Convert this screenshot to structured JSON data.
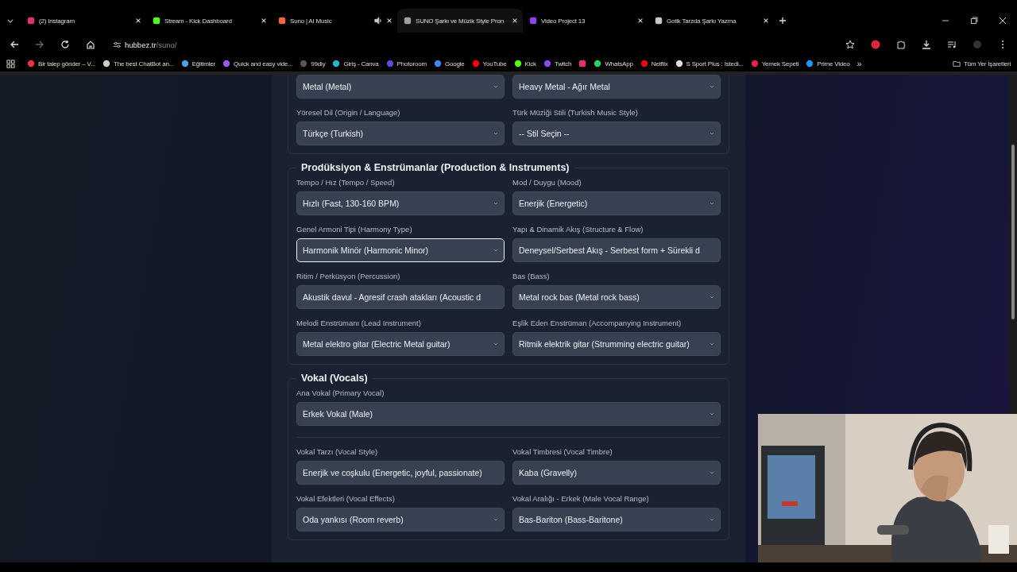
{
  "tabs": [
    {
      "title": "(2) Instagram",
      "selected": false,
      "audio": false
    },
    {
      "title": "Stream - Kick Dashboard",
      "selected": false,
      "audio": false
    },
    {
      "title": "Suno | AI Music",
      "selected": false,
      "audio": true
    },
    {
      "title": "SUNO Şarkı ve Müzik Style Pron",
      "selected": true,
      "audio": false
    },
    {
      "title": "Video Project 13",
      "selected": false,
      "audio": false
    },
    {
      "title": "Gotik Tarzda Şarkı Yazma",
      "selected": false,
      "audio": false
    }
  ],
  "address": {
    "host": "hubbez.tr",
    "path": "/suno/"
  },
  "bookmarks": [
    {
      "kind": "link",
      "label": "Bir talep gönder – V..."
    },
    {
      "kind": "link",
      "label": "The best ChatBot an..."
    },
    {
      "kind": "link",
      "label": "Eğitimler"
    },
    {
      "kind": "link",
      "label": "Quick and easy vide..."
    },
    {
      "kind": "link",
      "label": "99diy"
    },
    {
      "kind": "link",
      "label": "Giriş - Canva"
    },
    {
      "kind": "link",
      "label": "Photoroom"
    },
    {
      "kind": "link",
      "label": "Google"
    },
    {
      "kind": "link",
      "label": "YouTube"
    },
    {
      "kind": "link",
      "label": "Kick"
    },
    {
      "kind": "link",
      "label": "Twitch"
    },
    {
      "kind": "icon"
    },
    {
      "kind": "link",
      "label": "WhatsApp"
    },
    {
      "kind": "link",
      "label": "Netflix"
    },
    {
      "kind": "link",
      "label": "S Sport Plus : İstedi..."
    },
    {
      "kind": "link",
      "label": "Yemek Sepeti"
    },
    {
      "kind": "link",
      "label": "Prime Video"
    }
  ],
  "bookmarks_overflow": "»",
  "all_bookmarks": "Tüm Yer İşaretleri",
  "sections": [
    {
      "groups": [
        [
          {
            "value": "Metal (Metal)",
            "kind": "select",
            "focused": false
          },
          {
            "value": "Heavy Metal - Ağır Metal",
            "kind": "select",
            "focused": false
          },
          {
            "label": "Yöresel Dil (Origin / Language)",
            "value": "Türkçe (Turkish)",
            "kind": "select",
            "focused": false
          },
          {
            "label": "Türk Müziği Stili (Turkish Music Style)",
            "value": "-- Stil Seçin --",
            "kind": "select",
            "focused": false
          }
        ]
      ]
    },
    {
      "title": "Prodüksiyon & Enstrümanlar (Production & Instruments)",
      "groups": [
        [
          {
            "label": "Tempo / Hız (Tempo / Speed)",
            "value": "Hızlı (Fast, 130-160 BPM)",
            "kind": "select",
            "focused": false
          },
          {
            "label": "Mod / Duygu (Mood)",
            "value": "Enerjik (Energetic)",
            "kind": "select",
            "focused": false
          },
          {
            "label": "Genel Armoni Tipi (Harmony Type)",
            "value": "Harmonik Minör (Harmonic Minor)",
            "kind": "select",
            "focused": true
          },
          {
            "label": "Yapı & Dinamik Akış (Structure & Flow)",
            "value": "Deneysel/Serbest Akış - Serbest form + Sürekli d",
            "kind": "input",
            "focused": false
          },
          {
            "label": "Ritim / Perküsyon (Percussion)",
            "value": "Akustik davul - Agresif crash atakları (Acoustic d",
            "kind": "input",
            "focused": false
          },
          {
            "label": "Bas (Bass)",
            "value": "Metal rock bas (Metal rock bass)",
            "kind": "select",
            "focused": false
          },
          {
            "label": "Melodi Enstrümanı (Lead Instrument)",
            "value": "Metal elektro gitar (Electric Metal guitar)",
            "kind": "select",
            "focused": false
          },
          {
            "label": "Eşlik Eden Enstrüman (Accompanying Instrument)",
            "value": "Ritmik elektrik gitar (Strumming electric guitar)",
            "kind": "select",
            "focused": false
          }
        ]
      ]
    },
    {
      "title": "Vokal (Vocals)",
      "groups": [
        [
          {
            "label": "Ana Vokal (Primary Vocal)",
            "value": "Erkek Vokal (Male)",
            "kind": "select",
            "focused": false
          }
        ],
        [
          {
            "label": "Vokal Tarzı (Vocal Style)",
            "value": "Enerjik ve coşkulu (Energetic, joyful, passionate)",
            "kind": "input",
            "focused": false
          },
          {
            "label": "Vokal Timbresi (Vocal Timbre)",
            "value": "Kaba (Gravelly)",
            "kind": "select",
            "focused": false
          },
          {
            "label": "Vokal Efektleri (Vocal Effects)",
            "value": "Oda yankısı (Room reverb)",
            "kind": "select",
            "focused": false
          },
          {
            "label": "Vokal Aralığı - Erkek (Male Vocal Range)",
            "value": "Bas-Bariton (Bass-Baritone)",
            "kind": "select",
            "focused": false
          }
        ]
      ]
    }
  ]
}
